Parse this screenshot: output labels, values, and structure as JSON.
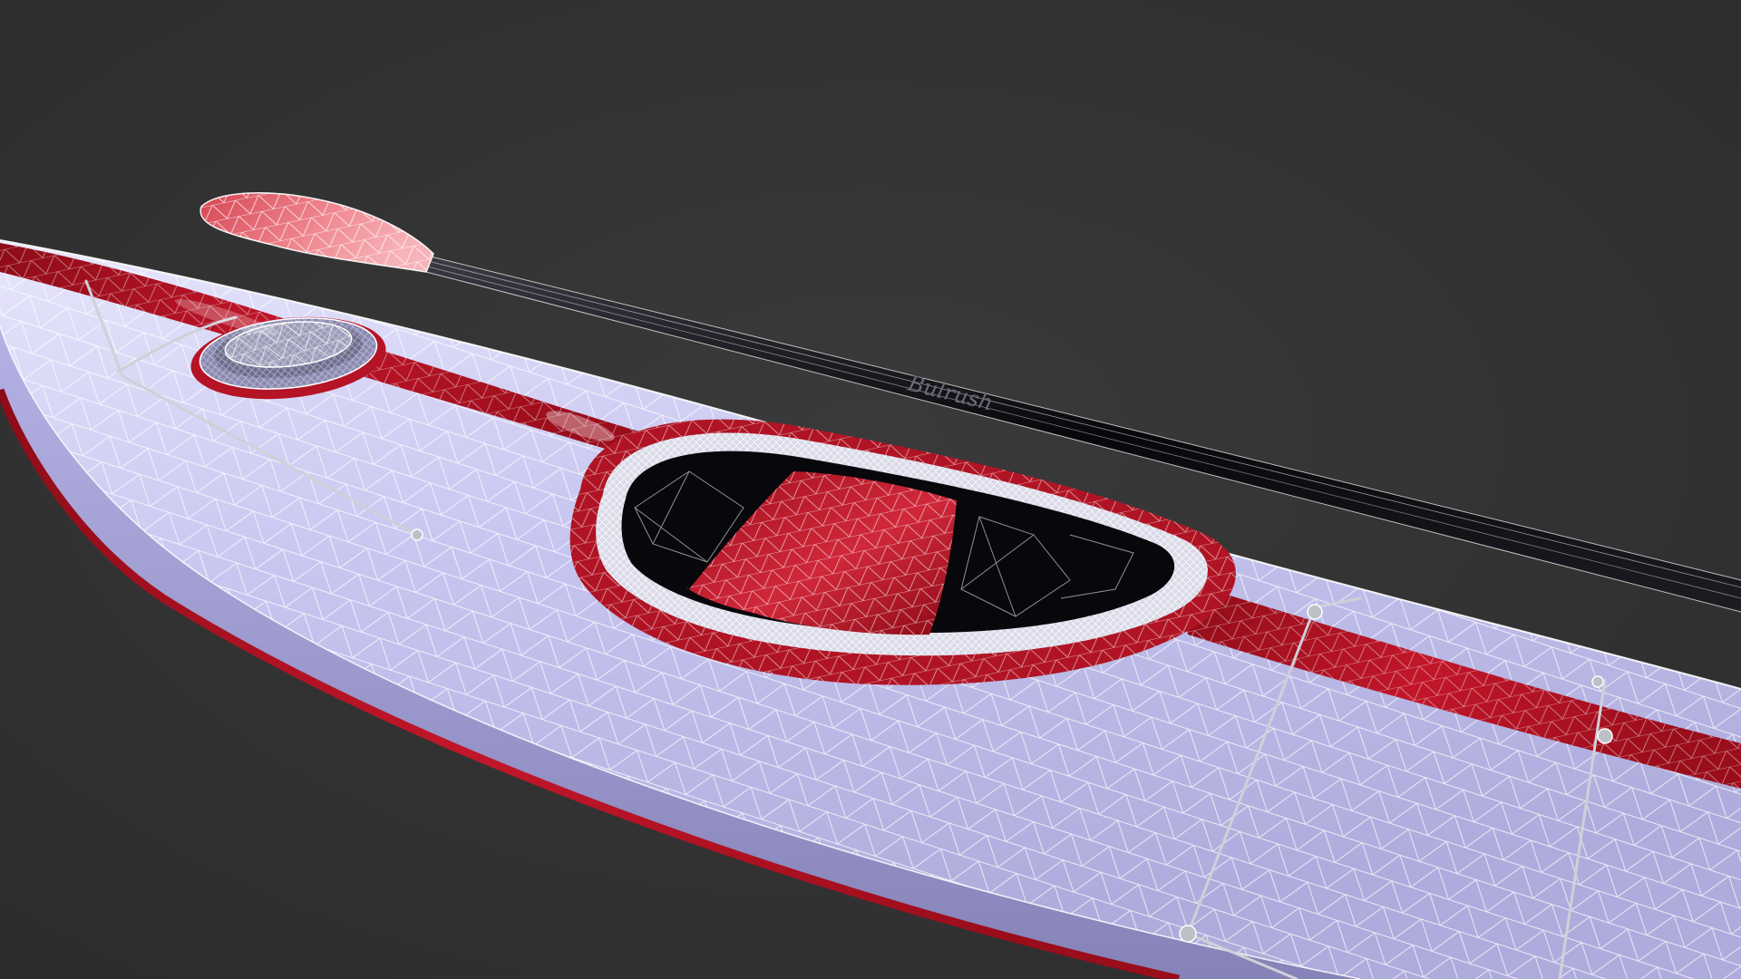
{
  "render": {
    "background_color": "#333333",
    "hull_color": "#c9c9f2",
    "stripe_color": "#b0101e",
    "wire_color": "#ffffff",
    "shaft_color": "#0d0d12",
    "blade_color": "#e96570",
    "cockpit_interior_color": "#08080c"
  },
  "objects": {
    "kayak": {
      "icon": "kayak-hull"
    },
    "paddle": {
      "icon": "kayak-paddle",
      "shaft_logo_text": "Bulrush"
    }
  }
}
